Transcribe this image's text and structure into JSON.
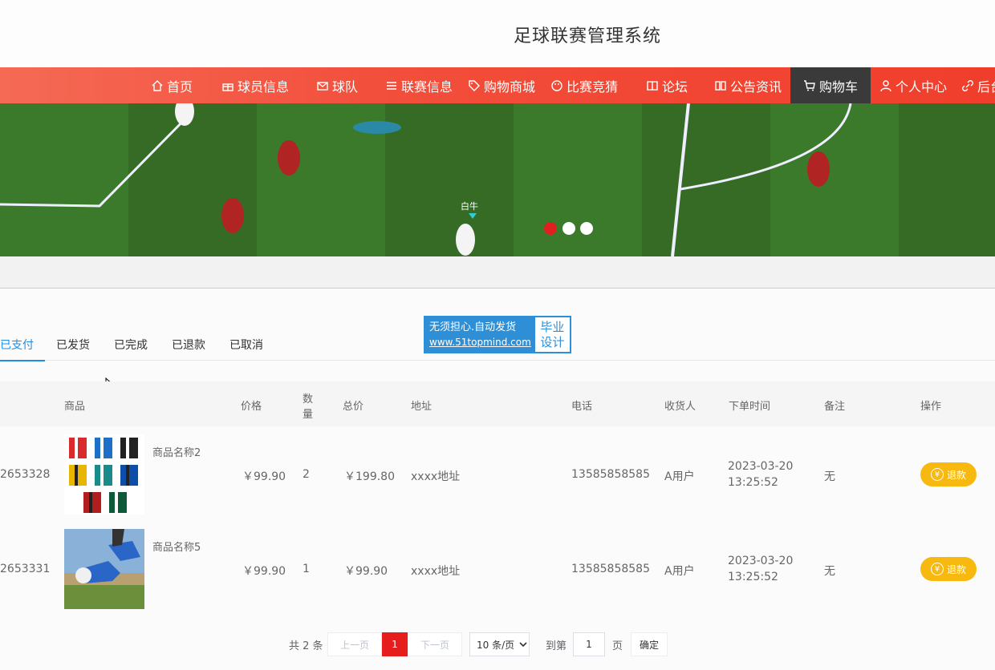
{
  "header": {
    "title": "足球联赛管理系统"
  },
  "nav": {
    "items": [
      {
        "label": "首页",
        "icon": "home-icon"
      },
      {
        "label": "球员信息",
        "icon": "gift-icon"
      },
      {
        "label": "球队",
        "icon": "mail-icon"
      },
      {
        "label": "联赛信息",
        "icon": "sliders-icon"
      },
      {
        "label": "购物商城",
        "icon": "tag-icon"
      },
      {
        "label": "比赛竞猜",
        "icon": "palette-icon"
      },
      {
        "label": "论坛",
        "icon": "columns-icon"
      },
      {
        "label": "公告资讯",
        "icon": "book-icon"
      },
      {
        "label": "购物车",
        "icon": "cart-icon",
        "active": true
      },
      {
        "label": "个人中心",
        "icon": "user-icon"
      },
      {
        "label": "后台",
        "icon": "link-icon"
      }
    ]
  },
  "banner": {
    "overlay_text": "白牛",
    "active_slide": 1,
    "slides": 3
  },
  "tabs": [
    {
      "label": "已支付",
      "active": true
    },
    {
      "label": "已发货"
    },
    {
      "label": "已完成"
    },
    {
      "label": "已退款"
    },
    {
      "label": "已取消"
    }
  ],
  "ad": {
    "line1": "无须担心.自动发货",
    "line2": "www.51topmind.com",
    "tag1": "毕业",
    "tag2": "设计"
  },
  "table": {
    "headers": {
      "product": "商品",
      "price": "价格",
      "qty_1": "数",
      "qty_2": "量",
      "total": "总价",
      "address": "地址",
      "phone": "电话",
      "receiver": "收货人",
      "order_time": "下单时间",
      "remark": "备注",
      "actions": "操作"
    },
    "rows": [
      {
        "order_no": "2653328",
        "product_name": "商品名称2",
        "price": "￥99.90",
        "qty": "2",
        "total": "￥199.80",
        "address": "xxxx地址",
        "phone": "13585858585",
        "receiver": "A用户",
        "time_date": "2023-03-20",
        "time_clock": "13:25:52",
        "remark": "无",
        "action": "退款"
      },
      {
        "order_no": "2653331",
        "product_name": "商品名称5",
        "price": "￥99.90",
        "qty": "1",
        "total": "￥99.90",
        "address": "xxxx地址",
        "phone": "13585858585",
        "receiver": "A用户",
        "time_date": "2023-03-20",
        "time_clock": "13:25:52",
        "remark": "无",
        "action": "退款"
      }
    ]
  },
  "pagination": {
    "total": "共 2 条",
    "prev": "上一页",
    "current": "1",
    "next": "下一页",
    "page_size": "10 条/页",
    "goto_label": "到第",
    "goto_value": "1",
    "page_unit": "页",
    "confirm": "确定"
  },
  "colors": {
    "nav": "#f24e3b",
    "active_nav": "#3a3a3a",
    "tab_active": "#1f8de5",
    "refund": "#f7b90f",
    "page_current": "#e61d1d"
  }
}
